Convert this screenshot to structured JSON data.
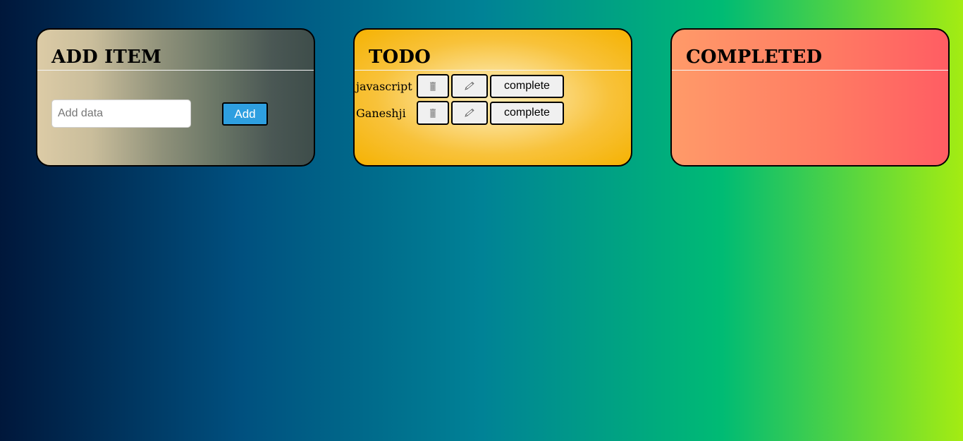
{
  "add_panel": {
    "title": "ADD ITEM",
    "input_placeholder": "Add data",
    "input_value": "",
    "add_label": "Add"
  },
  "todo_panel": {
    "title": "TODO",
    "items": [
      {
        "text": "javascript",
        "delete_icon": "trash-icon",
        "edit_icon": "pencil-icon",
        "complete_label": "complete"
      },
      {
        "text": "Ganeshji",
        "delete_icon": "trash-icon",
        "edit_icon": "pencil-icon",
        "complete_label": "complete"
      }
    ]
  },
  "completed_panel": {
    "title": "COMPLETED",
    "items": []
  },
  "colors": {
    "add_button": "#2e9fe0",
    "todo_panel": "#f5b202",
    "completed_panel": "#ff5d63"
  }
}
